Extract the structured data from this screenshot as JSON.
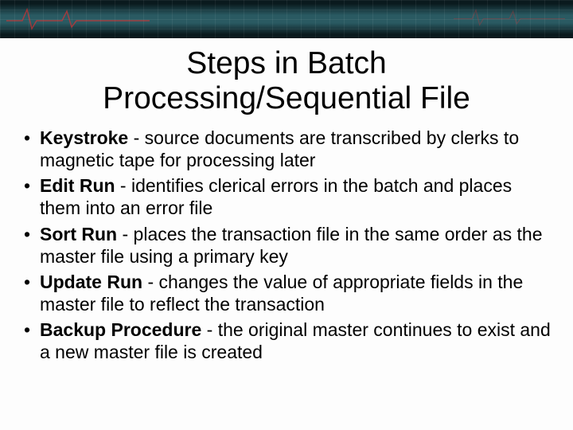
{
  "title": "Steps in Batch Processing/Sequential File",
  "bullets": [
    {
      "term": "Keystroke",
      "desc": " - source documents are transcribed by clerks to magnetic tape for processing later"
    },
    {
      "term": "Edit Run",
      "desc": " - identifies clerical errors in the batch and places them into an error file"
    },
    {
      "term": "Sort Run",
      "desc": " - places the transaction file in the same order as the master file using a primary key"
    },
    {
      "term": "Update Run",
      "desc": " - changes the value of appropriate fields in the master file to reflect the transaction"
    },
    {
      "term": "Backup Procedure",
      "desc": " - the original master continues to exist and a new master file is created"
    }
  ]
}
